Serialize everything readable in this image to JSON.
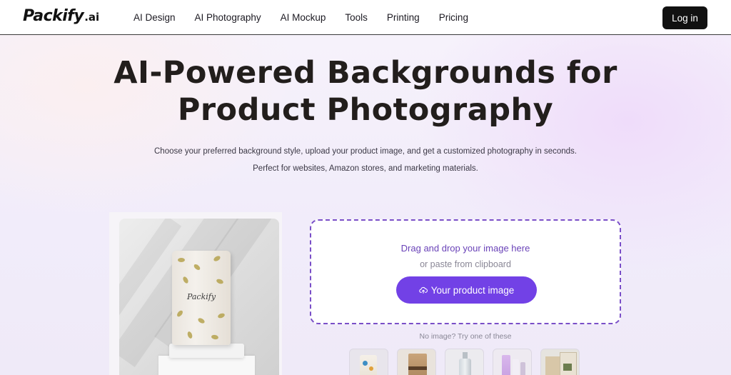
{
  "brand": {
    "name": "Packify",
    "suffix": ".ai"
  },
  "nav": {
    "items": [
      {
        "label": "AI Design"
      },
      {
        "label": "AI Photography"
      },
      {
        "label": "AI Mockup"
      },
      {
        "label": "Tools"
      },
      {
        "label": "Printing"
      },
      {
        "label": "Pricing"
      }
    ],
    "login_label": "Log in"
  },
  "hero": {
    "title": "AI-Powered Backgrounds for Product Photography",
    "description": "Choose your preferred background style, upload your product image, and get a customized photography in seconds. Perfect for websites, Amazon stores, and marketing materials."
  },
  "preview": {
    "product_label": "Packify"
  },
  "upload": {
    "drag_text": "Drag and drop your image here",
    "paste_text": "or paste from clipboard",
    "button_label": "Your product image",
    "button_icon": "upload-cloud-icon",
    "no_image_text": "No image? Try one of these"
  },
  "samples": [
    {
      "name": "sample-floral-pouch"
    },
    {
      "name": "sample-kraft-bag"
    },
    {
      "name": "sample-bottle"
    },
    {
      "name": "sample-cosmetic-tubes"
    },
    {
      "name": "sample-boxes"
    }
  ],
  "colors": {
    "accent": "#7241e6",
    "accent_text": "#6a43b8",
    "dashed_border": "#7a4fc8",
    "login_bg": "#111111"
  }
}
